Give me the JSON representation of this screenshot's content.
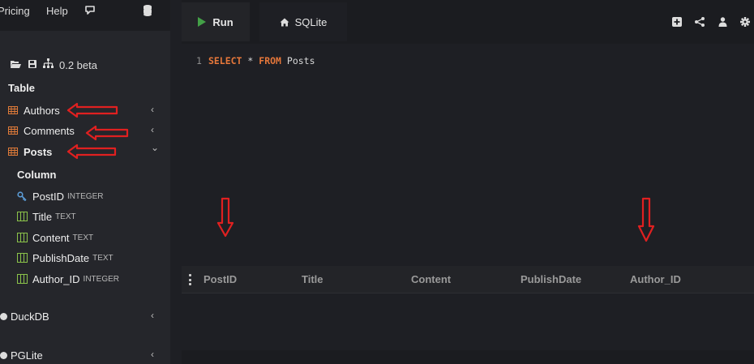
{
  "topnav": {
    "pricing": "Pricing",
    "help": "Help",
    "chat_icon": "chat-bubble-icon",
    "database_icon": "database-icon"
  },
  "sidebar": {
    "toolbar": {
      "open_icon": "folder-open-icon",
      "save_icon": "save-icon",
      "schema_icon": "sitemap-icon",
      "version": "0.2 beta"
    },
    "table_heading": "Table",
    "tables": [
      {
        "label": "Authors",
        "chevron": "‹"
      },
      {
        "label": "Comments",
        "chevron": "‹"
      },
      {
        "label": "Posts",
        "chevron": "⌄"
      }
    ],
    "column_heading": "Column",
    "columns": [
      {
        "name": "PostID",
        "type": "INTEGER",
        "icon": "key-icon"
      },
      {
        "name": "Title",
        "type": "TEXT",
        "icon": "column-icon"
      },
      {
        "name": "Content",
        "type": "TEXT",
        "icon": "column-icon"
      },
      {
        "name": "PublishDate",
        "type": "TEXT",
        "icon": "column-icon"
      },
      {
        "name": "Author_ID",
        "type": "INTEGER",
        "icon": "column-icon"
      }
    ],
    "databases": [
      {
        "label": "DuckDB",
        "chevron": "‹"
      },
      {
        "label": "PGLite",
        "chevron": "‹"
      }
    ]
  },
  "toolbar": {
    "run_label": "Run",
    "tab_label": "SQLite",
    "icons": [
      "add-icon",
      "share-icon",
      "user-icon",
      "gear-icon"
    ]
  },
  "editor": {
    "line_number": "1",
    "tokens": {
      "select": "SELECT",
      "star": " * ",
      "from": "FROM",
      "table": " Posts"
    }
  },
  "results": {
    "columns": [
      "PostID",
      "Title",
      "Content",
      "PublishDate",
      "Author_ID"
    ]
  },
  "colors": {
    "accent_run": "#43a047",
    "keyword": "#e6773a",
    "table_icon": "#e07b39",
    "column_icon": "#8bc34a",
    "key_icon": "#5b9bd5",
    "annotation": "#e02020"
  }
}
